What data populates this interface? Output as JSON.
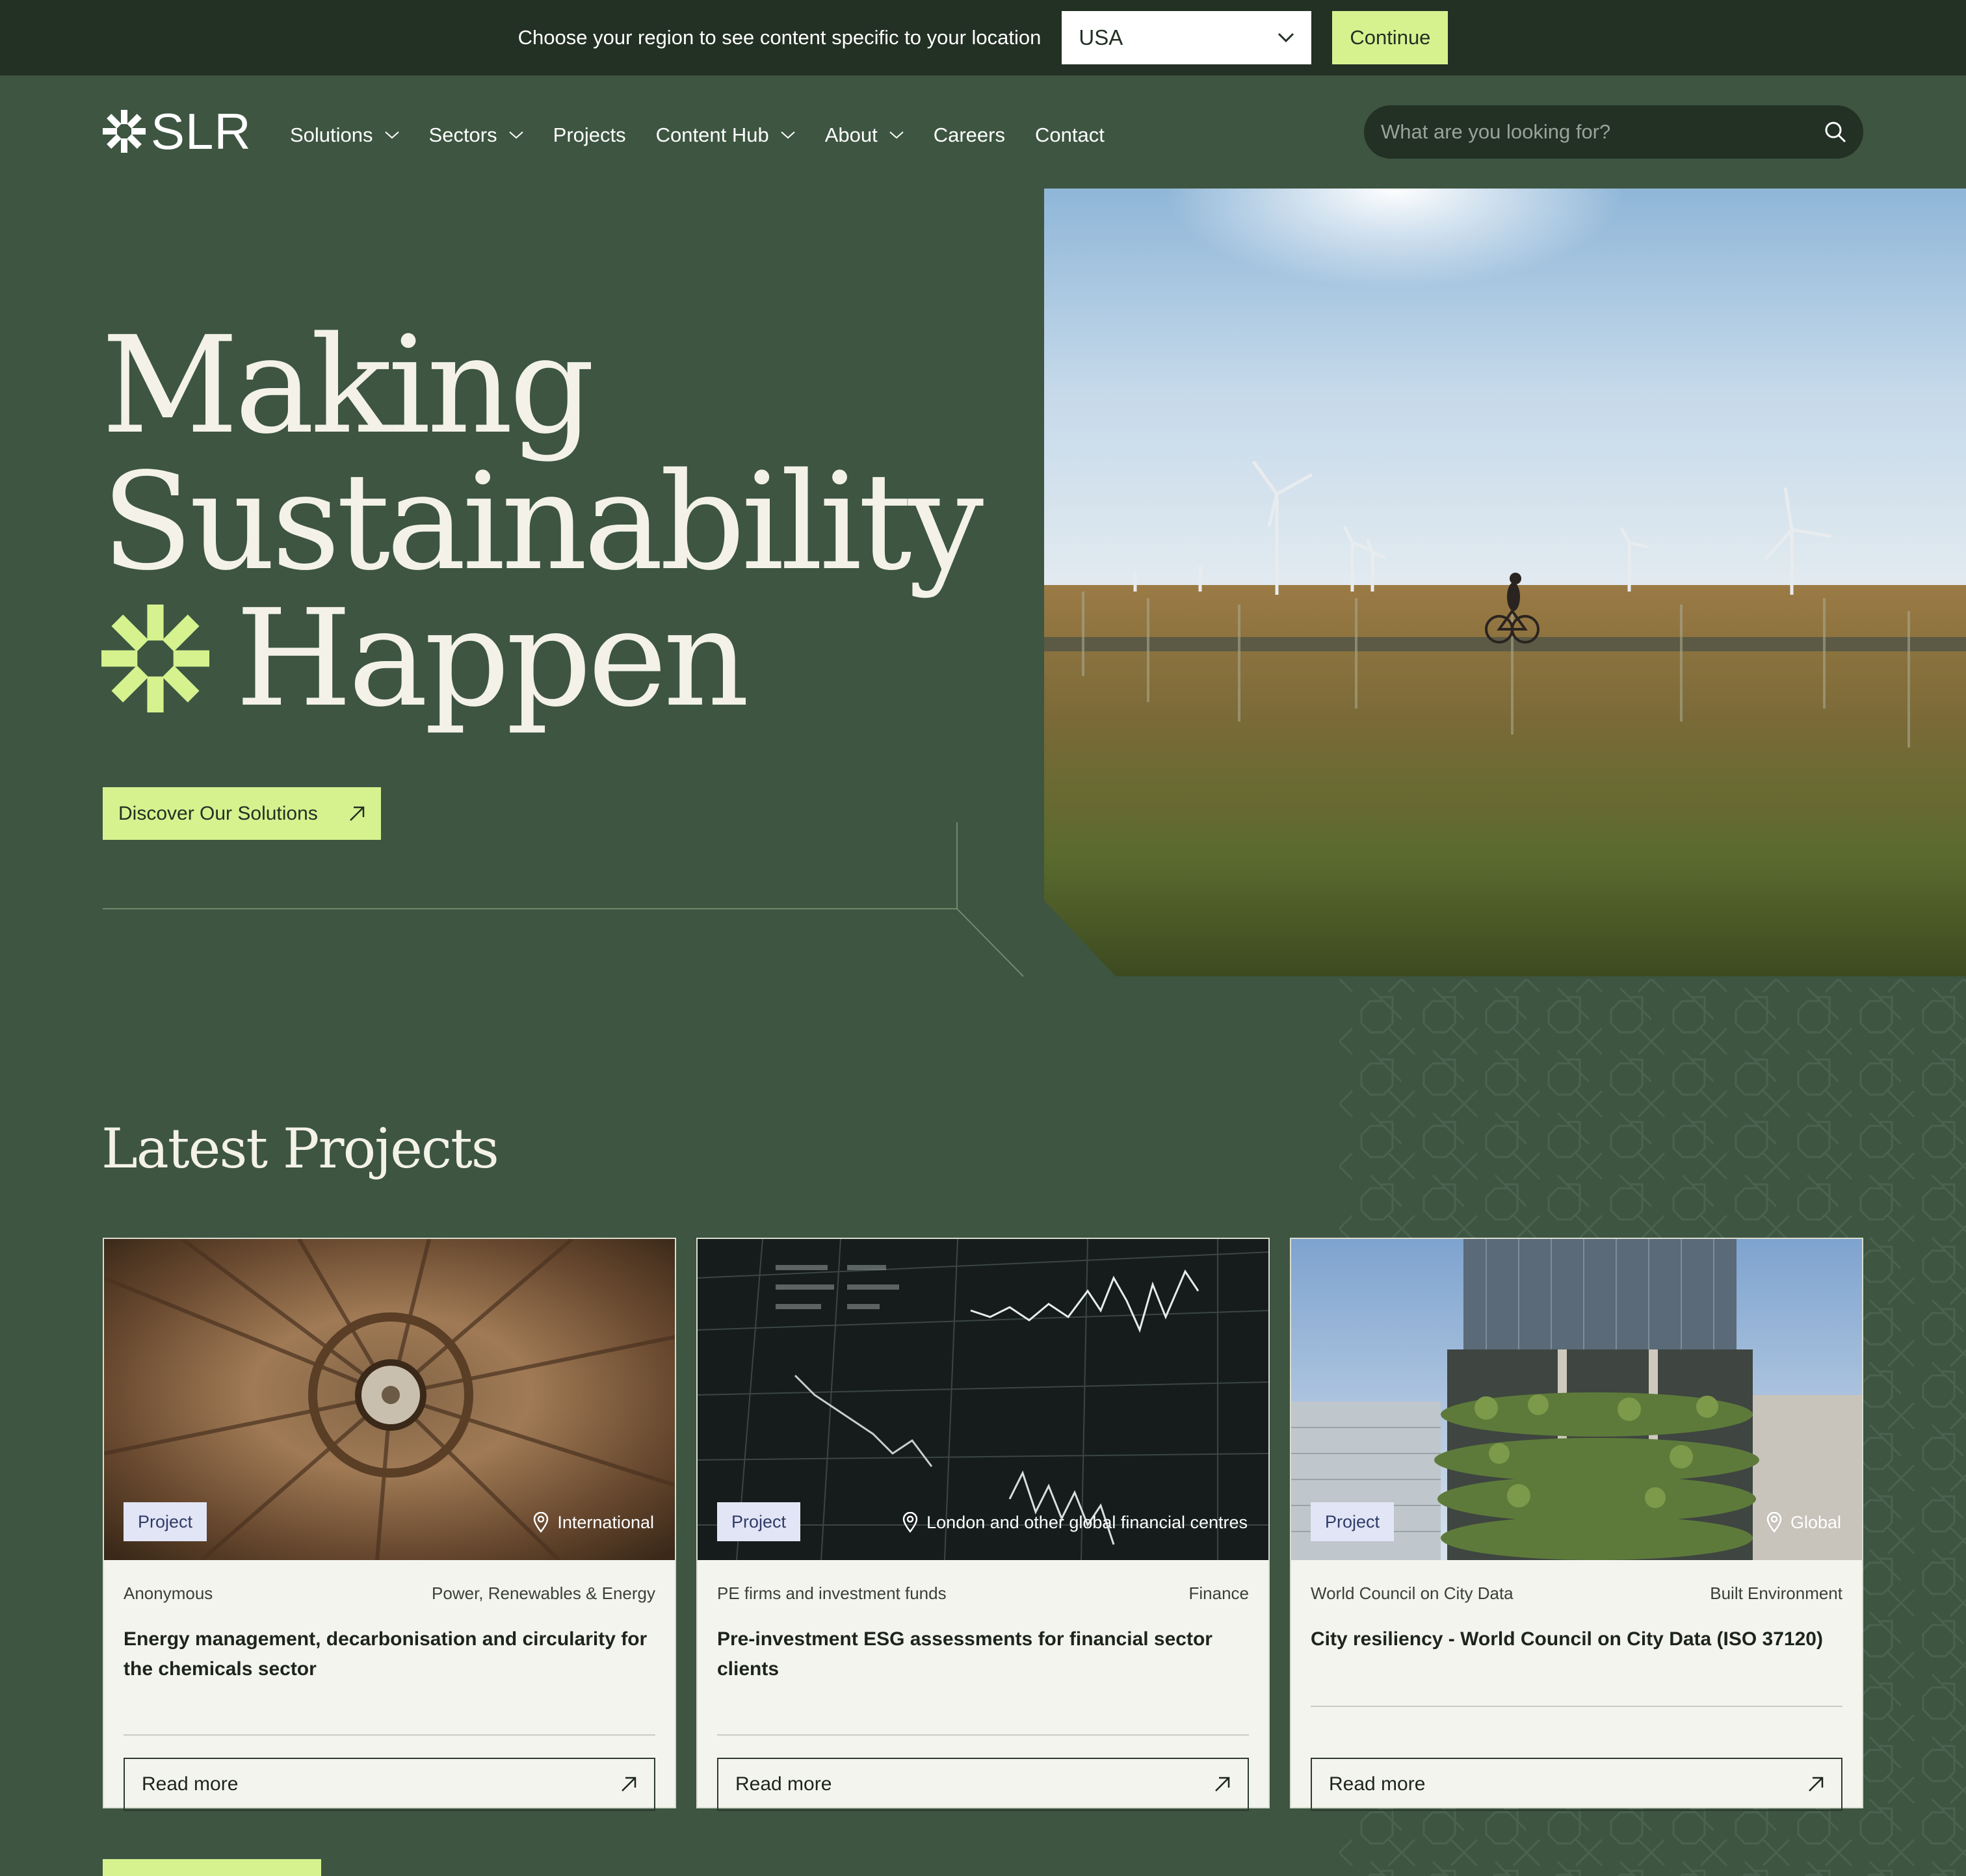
{
  "region_bar": {
    "prompt": "Choose your region to see content specific to your location",
    "selected_region": "USA",
    "continue_label": "Continue"
  },
  "header": {
    "logo_text": "SLR",
    "nav": [
      {
        "label": "Solutions",
        "has_dropdown": true
      },
      {
        "label": "Sectors",
        "has_dropdown": true
      },
      {
        "label": "Projects",
        "has_dropdown": false
      },
      {
        "label": "Content Hub",
        "has_dropdown": true
      },
      {
        "label": "About",
        "has_dropdown": true
      },
      {
        "label": "Careers",
        "has_dropdown": false
      },
      {
        "label": "Contact",
        "has_dropdown": false
      }
    ],
    "search_placeholder": "What are you looking for?"
  },
  "hero": {
    "title_line1": "Making",
    "title_line2": "Sustainability",
    "title_line3": "Happen",
    "cta_label": "Discover Our Solutions"
  },
  "latest_projects": {
    "title": "Latest Projects",
    "cards": [
      {
        "tag": "Project",
        "location": "International",
        "client": "Anonymous",
        "sector": "Power, Renewables & Energy",
        "title": "Energy management, decarbonisation and circularity for the chemicals sector",
        "read_more": "Read more"
      },
      {
        "tag": "Project",
        "location": "London and other global financial centres",
        "client": "PE firms and investment funds",
        "sector": "Finance",
        "title": "Pre-investment ESG assessments for financial sector clients",
        "read_more": "Read more"
      },
      {
        "tag": "Project",
        "location": "Global",
        "client": "World Council on City Data",
        "sector": "Built Environment",
        "title": "City resiliency - World Council on City Data (ISO 37120)",
        "read_more": "Read more"
      }
    ]
  },
  "colors": {
    "background": "#3d5541",
    "top_bar": "#233024",
    "accent": "#d5f28f",
    "card_background": "#f4f4ef",
    "tag_background": "#e2e5f6"
  }
}
